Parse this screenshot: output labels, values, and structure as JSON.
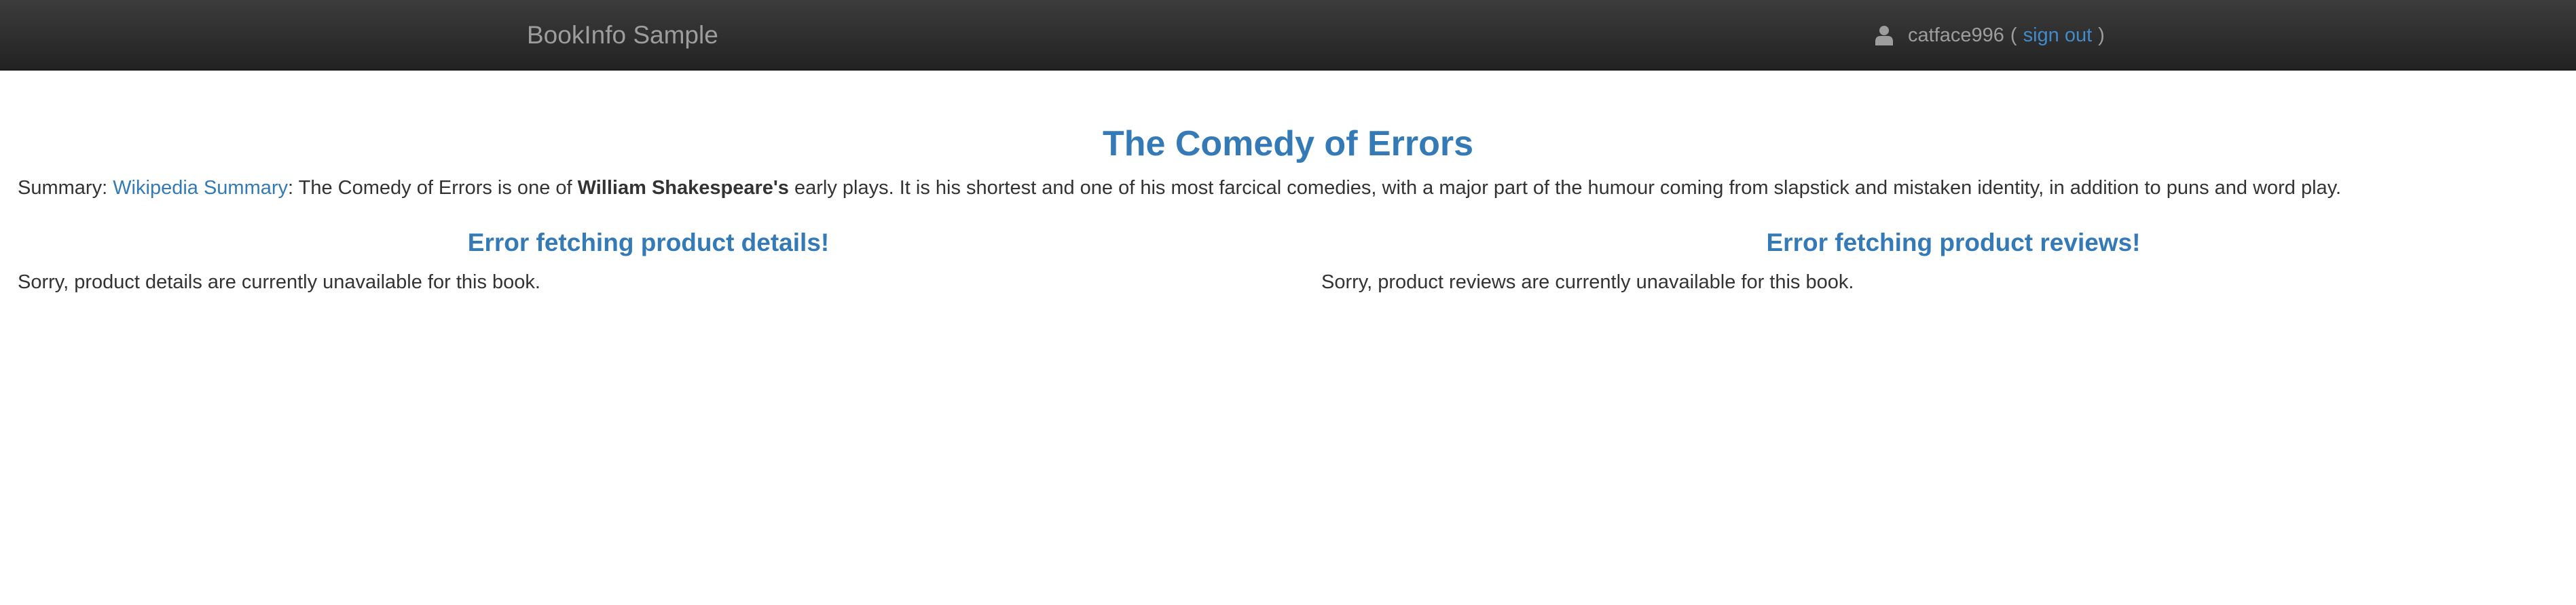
{
  "navbar": {
    "brand": "BookInfo Sample",
    "username": "catface996",
    "open_paren": "(",
    "sign_out": "sign out",
    "close_paren": ")",
    "user_icon": "user-icon"
  },
  "product": {
    "title": "The Comedy of Errors",
    "summary_prefix": "Summary: ",
    "summary_link": "Wikipedia Summary",
    "summary_text_1": ": The Comedy of Errors is one of ",
    "summary_bold": "William Shakespeare's",
    "summary_text_2": " early plays. It is his shortest and one of his most farcical comedies, with a major part of the humour coming from slapstick and mistaken identity, in addition to puns and word play."
  },
  "details": {
    "heading": "Error fetching product details!",
    "message": "Sorry, product details are currently unavailable for this book."
  },
  "reviews": {
    "heading": "Error fetching product reviews!",
    "message": "Sorry, product reviews are currently unavailable for this book."
  },
  "colors": {
    "navbar_bg": "#2b2b2b",
    "link": "#337ab7",
    "muted": "#9d9d9d",
    "text": "#333333"
  }
}
